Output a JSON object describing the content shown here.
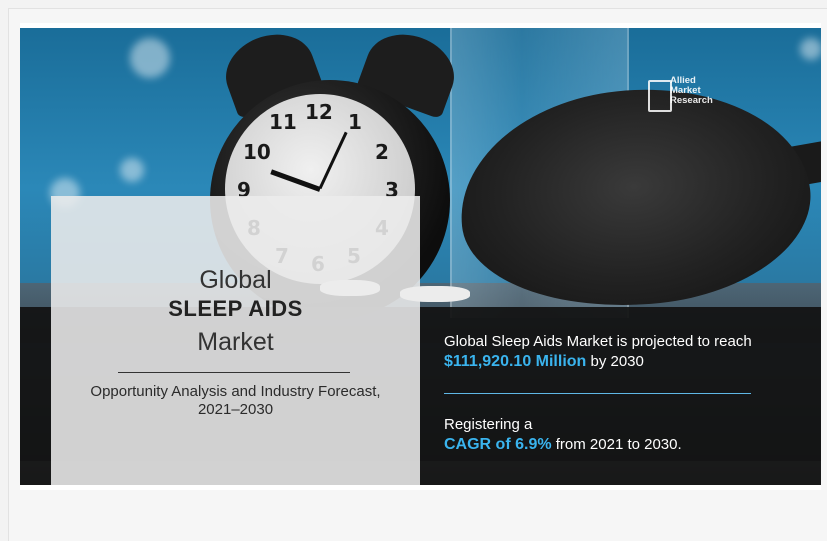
{
  "brand": {
    "logo_lines": [
      "Allied",
      "Market",
      "Research"
    ]
  },
  "title": {
    "line1": "Global",
    "line2": "SLEEP AIDS",
    "line3": "Market",
    "subtitle": "Opportunity Analysis and Industry Forecast,",
    "subtitle_years": "2021–2030"
  },
  "fact1": {
    "text_before": "Global Sleep Aids Market is projected to reach ",
    "highlight": "$111,920.10 Million",
    "text_after": " by 2030"
  },
  "fact2": {
    "text_before": "Registering a ",
    "highlight": "CAGR of 6.9%",
    "text_after": " from 2021 to 2030."
  },
  "clock_numbers": [
    "12",
    "1",
    "2",
    "3",
    "4",
    "5",
    "6",
    "7",
    "8",
    "9",
    "10",
    "11"
  ],
  "colors": {
    "highlight": "#3ab4ee",
    "band": "#121212",
    "panel": "#ececec"
  }
}
